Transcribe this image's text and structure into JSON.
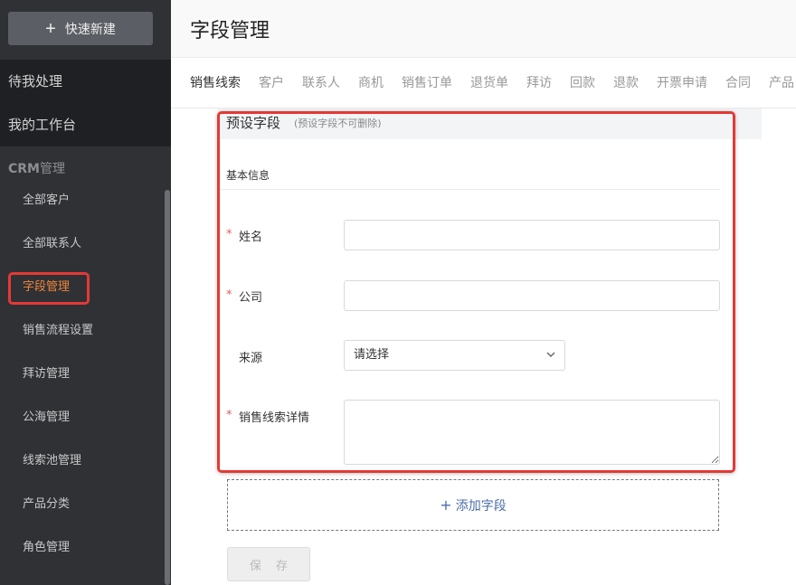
{
  "sidebar": {
    "quick_new_label": "快速新建",
    "top_items": [
      "待我处理",
      "我的工作台"
    ],
    "crm_prefix": "CRM",
    "crm_suffix": "管理",
    "menu": [
      {
        "label": "全部客户",
        "active": false
      },
      {
        "label": "全部联系人",
        "active": false
      },
      {
        "label": "字段管理",
        "active": true
      },
      {
        "label": "销售流程设置",
        "active": false
      },
      {
        "label": "拜访管理",
        "active": false
      },
      {
        "label": "公海管理",
        "active": false
      },
      {
        "label": "线索池管理",
        "active": false
      },
      {
        "label": "产品分类",
        "active": false
      },
      {
        "label": "角色管理",
        "active": false
      }
    ],
    "active_color": "#f0863a"
  },
  "header": {
    "title": "字段管理"
  },
  "tabs": [
    "销售线索",
    "客户",
    "联系人",
    "商机",
    "销售订单",
    "退货单",
    "拜访",
    "回款",
    "退款",
    "开票申请",
    "合同",
    "产品"
  ],
  "active_tab": 0,
  "preset": {
    "title": "预设字段",
    "note": "(预设字段不可删除)"
  },
  "section": {
    "title": "基本信息"
  },
  "fields": {
    "name": {
      "label": "姓名",
      "required": "*",
      "value": ""
    },
    "company": {
      "label": "公司",
      "required": "*",
      "value": ""
    },
    "source": {
      "label": "来源",
      "placeholder": "请选择"
    },
    "detail": {
      "label": "销售线索详情",
      "required": "*",
      "value": ""
    }
  },
  "actions": {
    "add_field_label": "添加字段",
    "save_label": "保 存"
  },
  "colors": {
    "highlight": "#e53935",
    "link": "#4a6ea9"
  }
}
